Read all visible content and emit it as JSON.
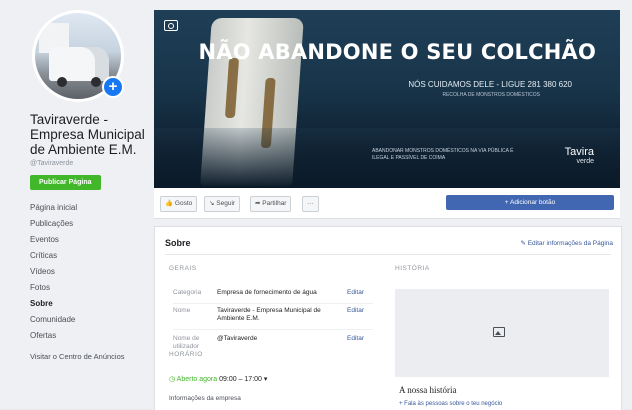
{
  "page": {
    "name": "Taviraverde - Empresa Municipal de Ambiente E.M.",
    "handle": "@Taviraverde",
    "create_button": "Publicar Página"
  },
  "nav": [
    {
      "label": "Página inicial"
    },
    {
      "label": "Publicações"
    },
    {
      "label": "Eventos"
    },
    {
      "label": "Críticas"
    },
    {
      "label": "Vídeos"
    },
    {
      "label": "Fotos"
    },
    {
      "label": "Sobre",
      "active": true
    },
    {
      "label": "Comunidade"
    },
    {
      "label": "Ofertas"
    }
  ],
  "promo_link": "Visitar o Centro de Anúncios",
  "cover": {
    "title": "NÃO ABANDONE O SEU COLCHÃO",
    "subtitle": "NÓS CUIDAMOS DELE - LIGUE 281 380 620",
    "subtitle2": "RECOLHA DE MONSTROS DOMÉSTICOS",
    "note": "ABANDONAR MONSTROS DOMÉSTICOS NA VIA PÚBLICA É ILEGAL E PASSÍVEL DE COIMA",
    "logo": "Tavira",
    "logo_sub": "verde",
    "camera_icon": "camera-icon"
  },
  "actions": {
    "like": "Gosto",
    "follow": "Seguir",
    "share": "Partilhar",
    "more": "···",
    "add_button": "+ Adicionar botão"
  },
  "about": {
    "title": "Sobre",
    "edit_link": "Editar informações da Página",
    "general_label": "GERAIS",
    "rows": [
      {
        "key": "Categoria",
        "value": "Empresa de fornecimento de água",
        "edit": "Editar"
      },
      {
        "key": "Nome",
        "value": "Taviraverde - Empresa Municipal de Ambiente E.M.",
        "edit": "Editar"
      },
      {
        "key": "Nome de utilizador",
        "value": "@Taviraverde",
        "edit": "Editar"
      }
    ],
    "hours_label": "HORÁRIO",
    "hours_open": "Aberto agora",
    "hours_range": "09:00 – 17:00 ▾",
    "business_info": "Informações da empresa",
    "history_label": "HISTÓRIA",
    "history_title": "A nossa história",
    "history_sub": "+ Fala às pessoas sobre o teu negócio"
  }
}
